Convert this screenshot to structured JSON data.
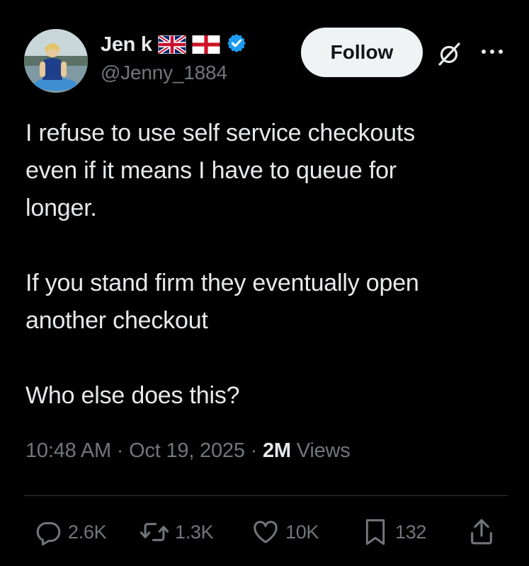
{
  "author": {
    "display_name": "Jen k",
    "handle": "@Jenny_1884",
    "verified": true,
    "flags": [
      "uk-flag-icon",
      "england-flag-icon"
    ],
    "avatar": "profile-photo"
  },
  "header": {
    "follow_label": "Follow",
    "grok_icon": "grok-icon",
    "more_icon": "more-options-icon"
  },
  "tweet": {
    "paragraphs": [
      "I refuse to use self service checkouts\neven if it means I have to queue for\nlonger.",
      "If you stand firm they eventually open\nanother checkout",
      "Who else does this?"
    ]
  },
  "meta": {
    "time": "10:48 AM",
    "separator": "·",
    "date": "Oct 19, 2025",
    "views_count": "2M",
    "views_label": "Views"
  },
  "actions": {
    "replies": "2.6K",
    "reposts": "1.3K",
    "likes": "10K",
    "bookmarks": "132"
  },
  "colors": {
    "background": "#000000",
    "primary_text": "#e7e9ea",
    "secondary_text": "#71767b",
    "divider": "#2f3336",
    "follow_bg": "#eff3f4",
    "verified_blue": "#1d9bf0"
  }
}
